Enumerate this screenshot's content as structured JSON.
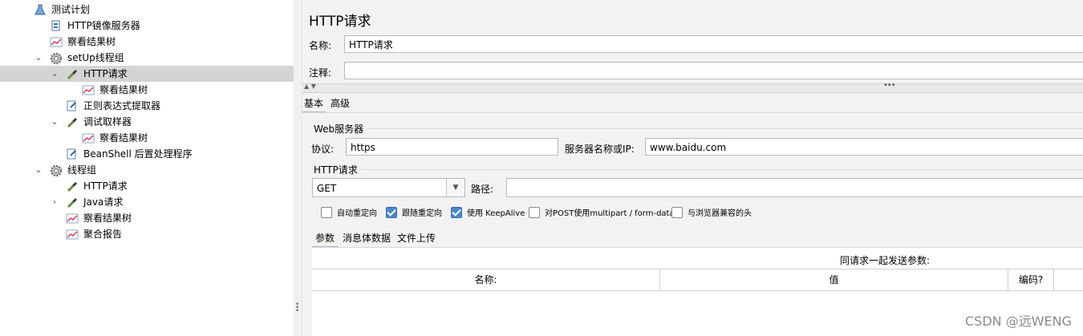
{
  "tree": [
    {
      "label": "测试计划",
      "icon": "flask-icon",
      "indent": 0,
      "toggle": "",
      "selected": false,
      "name": "tree-item-test-plan"
    },
    {
      "label": "HTTP镜像服务器",
      "icon": "server-icon",
      "indent": 1,
      "toggle": "",
      "selected": false,
      "name": "tree-item-http-mirror-server"
    },
    {
      "label": "察看结果树",
      "icon": "chart-icon",
      "indent": 1,
      "toggle": "",
      "selected": false,
      "name": "tree-item-view-results-tree"
    },
    {
      "label": "setUp线程组",
      "icon": "gear-icon",
      "indent": 1,
      "toggle": "expanded",
      "selected": false,
      "name": "tree-item-setup-thread-group"
    },
    {
      "label": "HTTP请求",
      "icon": "pipette-icon",
      "indent": 2,
      "toggle": "expanded",
      "selected": true,
      "name": "tree-item-http-request-selected"
    },
    {
      "label": "察看结果树",
      "icon": "chart-icon",
      "indent": 3,
      "toggle": "",
      "selected": false,
      "name": "tree-item-view-results-tree"
    },
    {
      "label": "正则表达式提取器",
      "icon": "extractor-icon",
      "indent": 2,
      "toggle": "",
      "selected": false,
      "name": "tree-item-regex-extractor"
    },
    {
      "label": "调试取样器",
      "icon": "pipette-icon",
      "indent": 2,
      "toggle": "expanded",
      "selected": false,
      "name": "tree-item-debug-sampler"
    },
    {
      "label": "察看结果树",
      "icon": "chart-icon",
      "indent": 3,
      "toggle": "",
      "selected": false,
      "name": "tree-item-view-results-tree"
    },
    {
      "label": "BeanShell 后置处理程序",
      "icon": "extractor-icon",
      "indent": 2,
      "toggle": "",
      "selected": false,
      "name": "tree-item-beanshell-postprocessor"
    },
    {
      "label": "线程组",
      "icon": "gear-icon",
      "indent": 1,
      "toggle": "expanded",
      "selected": false,
      "name": "tree-item-thread-group"
    },
    {
      "label": "HTTP请求",
      "icon": "pipette-icon",
      "indent": 2,
      "toggle": "",
      "selected": false,
      "name": "tree-item-http-request"
    },
    {
      "label": "Java请求",
      "icon": "pipette-icon",
      "indent": 2,
      "toggle": "collapsed",
      "selected": false,
      "name": "tree-item-java-request"
    },
    {
      "label": "察看结果树",
      "icon": "chart-icon",
      "indent": 2,
      "toggle": "",
      "selected": false,
      "name": "tree-item-view-results-tree"
    },
    {
      "label": "聚合报告",
      "icon": "chart-icon",
      "indent": 2,
      "toggle": "",
      "selected": false,
      "name": "tree-item-aggregate-report"
    }
  ],
  "panel": {
    "title": "HTTP请求",
    "name_label": "名称:",
    "name_value": "HTTP请求",
    "comment_label": "注释:",
    "comment_value": "",
    "tabs": [
      "基本",
      "高级"
    ],
    "web_server": {
      "section_label": "Web服务器",
      "protocol_label": "协议:",
      "protocol_value": "https",
      "server_label": "服务器名称或IP:",
      "server_value": "www.baidu.com"
    },
    "http_request": {
      "section_label": "HTTP请求",
      "method_value": "GET",
      "path_label": "路径:",
      "path_value": ""
    },
    "checkboxes": [
      {
        "label": "自动重定向",
        "checked": false
      },
      {
        "label": "跟随重定向",
        "checked": true
      },
      {
        "label": "使用 KeepAlive",
        "checked": true
      },
      {
        "label": "对POST使用multipart / form-data",
        "checked": false
      },
      {
        "label": "与浏览器兼容的头",
        "checked": false
      }
    ],
    "sub_tabs": [
      "参数",
      "消息体数据",
      "文件上传"
    ],
    "params_caption": "同请求一起发送参数:",
    "columns": [
      "名称:",
      "值",
      "编码?",
      ""
    ]
  },
  "watermark": "CSDN @远WENG",
  "colors": {
    "selected_row": "#d4d4d4",
    "panel_bg": "#f2f2f2",
    "checkbox_checked": "#4a86c8"
  }
}
